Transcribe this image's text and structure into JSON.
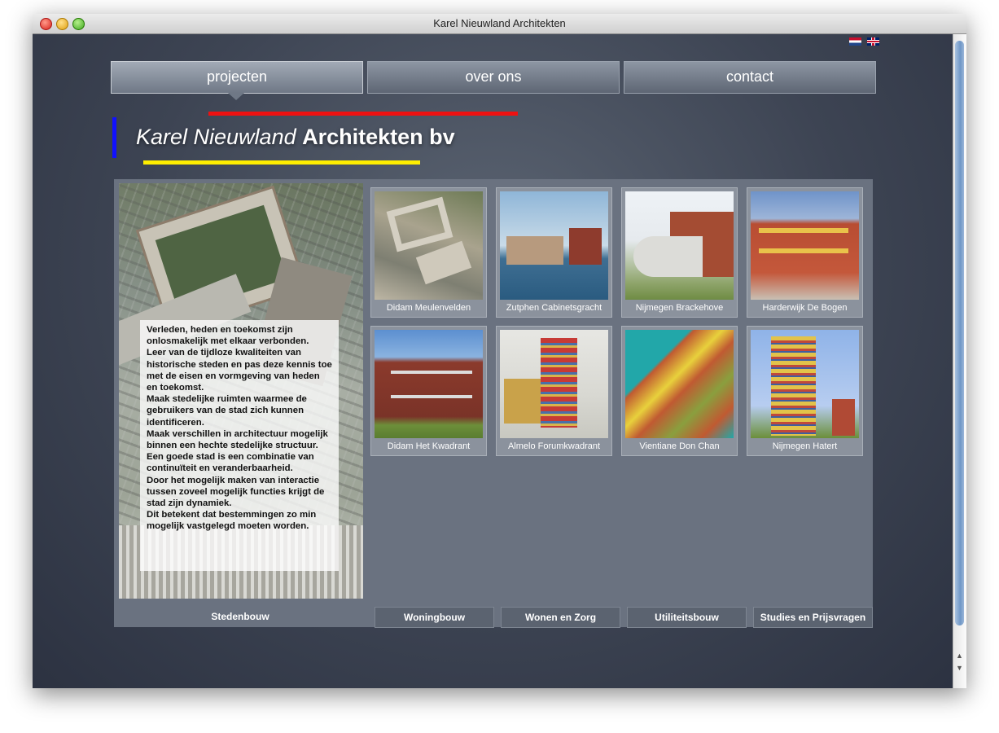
{
  "window": {
    "title": "Karel Nieuwland Architekten"
  },
  "languages": [
    "nl",
    "en"
  ],
  "nav": {
    "tabs": [
      {
        "label": "projecten",
        "active": true
      },
      {
        "label": "over ons",
        "active": false
      },
      {
        "label": "contact",
        "active": false
      }
    ]
  },
  "heading": {
    "name": "Karel Nieuwland",
    "company": "Architekten bv"
  },
  "colors": {
    "red": "#ee1111",
    "yellow": "#ffee00",
    "blue": "#1111ff"
  },
  "intro": {
    "lines": [
      "Verleden, heden en toekomst zijn onlosmakelijk met elkaar verbonden.",
      "Leer van de tijdloze kwaliteiten van historische steden en pas deze kennis toe met de eisen en vormgeving van heden en toekomst.",
      "Maak stedelijke ruimten waarmee de gebruikers van de stad zich kunnen identificeren.",
      "Maak verschillen in architectuur mogelijk binnen een hechte stedelijke structuur.",
      "Een goede stad is een combinatie van continuïteit en veranderbaarheid.",
      "Door het mogelijk maken van interactie tussen zoveel mogelijk functies krijgt de stad zijn dynamiek.",
      "Dit betekent dat bestemmingen zo min mogelijk vastgelegd moeten worden."
    ]
  },
  "projects": [
    {
      "label": "Didam Meulenvelden"
    },
    {
      "label": "Zutphen Cabinetsgracht"
    },
    {
      "label": "Nijmegen Brackehove"
    },
    {
      "label": "Harderwijk De Bogen"
    },
    {
      "label": "Didam Het Kwadrant"
    },
    {
      "label": "Almelo Forumkwadrant"
    },
    {
      "label": "Vientiane Don Chan"
    },
    {
      "label": "Nijmegen Hatert"
    }
  ],
  "categories": {
    "main": "Stedenbouw",
    "items": [
      "Woningbouw",
      "Wonen en Zorg",
      "Utiliteitsbouw",
      "Studies en Prijsvragen"
    ]
  }
}
